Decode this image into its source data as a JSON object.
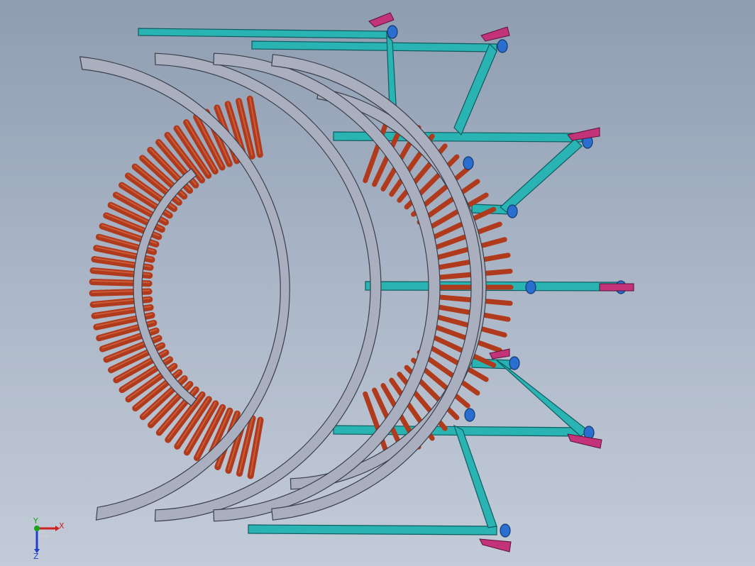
{
  "viewport": {
    "background_top": "#8f9db2",
    "background_bottom": "#c3cbd8"
  },
  "model": {
    "roller_color": "#b03a1c",
    "roller_highlight": "#d2643f",
    "frame_color": "#2ab3b3",
    "frame_edge": "#0d5b5f",
    "guard_color": "#a9afbe",
    "guard_edge": "#3b3f4a",
    "bracket_color": "#c2337a",
    "wheel_color": "#2a6fd0"
  },
  "triad": {
    "x_label": "X",
    "y_label": "Y",
    "z_label": "Z",
    "x_color": "#d01f1f",
    "y_color": "#19a319",
    "z_color": "#1f3fd0"
  }
}
